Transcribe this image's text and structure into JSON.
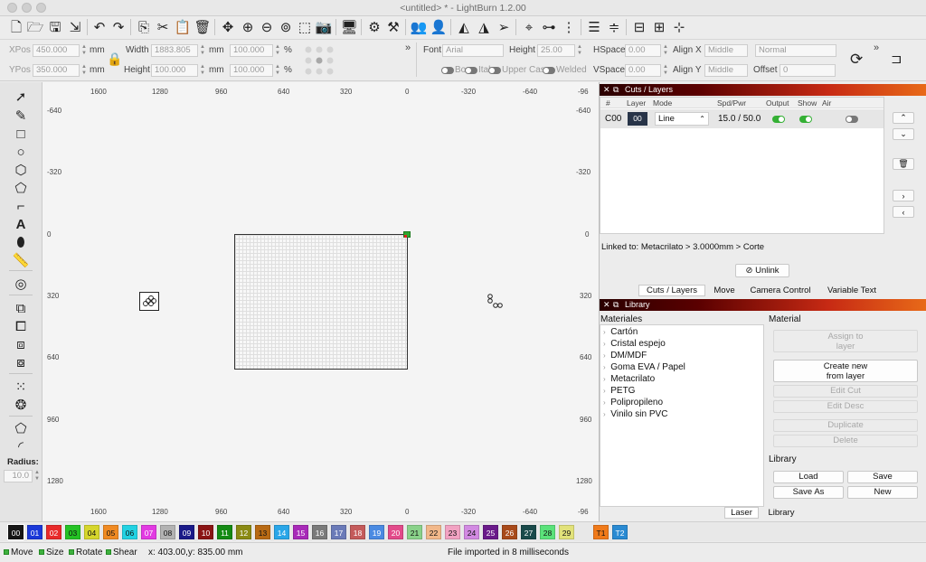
{
  "window": {
    "title": "<untitled> * - LightBurn 1.2.00"
  },
  "toolbar2": {
    "xpos_label": "XPos",
    "xpos_value": "450.000",
    "ypos_label": "YPos",
    "ypos_value": "350.000",
    "unit_mm": "mm",
    "width_label": "Width",
    "width_value": "1883.805",
    "height_label": "Height",
    "height_value": "100.000",
    "scale_w_value": "100.000",
    "scale_h_value": "100.000",
    "percent": "%",
    "font_label": "Font",
    "font_value": "Arial",
    "text_height_label": "Height",
    "text_height_value": "25.00",
    "hspace_label": "HSpace",
    "hspace_value": "0.00",
    "vspace_label": "VSpace",
    "vspace_value": "0.00",
    "alignx_label": "Align X",
    "alignx_value": "Middle",
    "aligny_label": "Align Y",
    "aligny_value": "Middle",
    "style_value": "Normal",
    "offset_label": "Offset",
    "offset_value": "0",
    "bold_label": "Bo",
    "italic_label": "Ital",
    "uppercase_label": "Upper Cas",
    "welded_label": "Welded",
    "overflow": "»"
  },
  "left_tools": {
    "radius_label": "Radius:",
    "radius_value": "10.0"
  },
  "rulers": {
    "top": [
      "1600",
      "1280",
      "960",
      "640",
      "320",
      "0",
      "-320",
      "-640",
      "-96"
    ],
    "bottom": [
      "1600",
      "1280",
      "960",
      "640",
      "320",
      "0",
      "-320",
      "-640",
      "-96"
    ],
    "left": [
      "-640",
      "-320",
      "0",
      "320",
      "640",
      "960",
      "1280"
    ],
    "right": [
      "-640",
      "-320",
      "0",
      "320",
      "640",
      "960",
      "1280"
    ]
  },
  "cuts": {
    "title": "Cuts / Layers",
    "headers": [
      "#",
      "Layer",
      "Mode",
      "Spd/Pwr",
      "Output",
      "Show",
      "Air"
    ],
    "row": {
      "id": "C00",
      "layer": "00",
      "mode": "Line",
      "spdpwr": "15.0 / 50.0",
      "layer_color": "#1a1a1a"
    },
    "linked": "Linked to: Metacrilato > 3.0000mm > Corte",
    "unlink": "Unlink",
    "tabs": [
      "Cuts / Layers",
      "Move",
      "Camera Control",
      "Variable Text"
    ]
  },
  "library": {
    "title": "Library",
    "materials_header": "Materiales",
    "materials": [
      "Cartón",
      "Cristal espejo",
      "DM/MDF",
      "Goma EVA / Papel",
      "Metacrilato",
      "PETG",
      "Polipropileno",
      "Vinilo sin PVC"
    ],
    "material_section": "Material",
    "assign": "Assign to layer",
    "create": "Create new from layer",
    "edit_cut": "Edit Cut",
    "edit_desc": "Edit Desc",
    "duplicate": "Duplicate",
    "delete": "Delete",
    "library_section": "Library",
    "load": "Load",
    "save": "Save",
    "save_as": "Save As",
    "new": "New",
    "bottom_tabs": [
      "Laser",
      "Library"
    ]
  },
  "palette": [
    {
      "label": "00",
      "color": "#161616",
      "fg": "#ffffff"
    },
    {
      "label": "01",
      "color": "#1a38d8",
      "fg": "#ffffff"
    },
    {
      "label": "02",
      "color": "#e82a2a",
      "fg": "#ffffff"
    },
    {
      "label": "03",
      "color": "#24c224",
      "fg": "#111111"
    },
    {
      "label": "04",
      "color": "#d6d62c",
      "fg": "#111111"
    },
    {
      "label": "05",
      "color": "#f08a22",
      "fg": "#111111"
    },
    {
      "label": "06",
      "color": "#22d2e2",
      "fg": "#111111"
    },
    {
      "label": "07",
      "color": "#e23ae2",
      "fg": "#ffffff"
    },
    {
      "label": "08",
      "color": "#b2b2b2",
      "fg": "#111111"
    },
    {
      "label": "09",
      "color": "#1a1a88",
      "fg": "#ffffff"
    },
    {
      "label": "10",
      "color": "#8a1414",
      "fg": "#ffffff"
    },
    {
      "label": "11",
      "color": "#148a14",
      "fg": "#ffffff"
    },
    {
      "label": "12",
      "color": "#8a8a14",
      "fg": "#ffffff"
    },
    {
      "label": "13",
      "color": "#b86a14",
      "fg": "#111111"
    },
    {
      "label": "14",
      "color": "#2aa6e8",
      "fg": "#ffffff"
    },
    {
      "label": "15",
      "color": "#a82ab8",
      "fg": "#ffffff"
    },
    {
      "label": "16",
      "color": "#7a7a7a",
      "fg": "#ffffff"
    },
    {
      "label": "17",
      "color": "#6a7ab8",
      "fg": "#ffffff"
    },
    {
      "label": "18",
      "color": "#c45a5a",
      "fg": "#ffffff"
    },
    {
      "label": "19",
      "color": "#4a8ae2",
      "fg": "#ffffff"
    },
    {
      "label": "20",
      "color": "#e24a8a",
      "fg": "#ffffff"
    },
    {
      "label": "21",
      "color": "#8ad28a",
      "fg": "#111111"
    },
    {
      "label": "22",
      "color": "#f2b88a",
      "fg": "#111111"
    },
    {
      "label": "23",
      "color": "#f2a2c2",
      "fg": "#111111"
    },
    {
      "label": "24",
      "color": "#d28ae2",
      "fg": "#111111"
    },
    {
      "label": "25",
      "color": "#6a1a8a",
      "fg": "#ffffff"
    },
    {
      "label": "26",
      "color": "#a84a1a",
      "fg": "#ffffff"
    },
    {
      "label": "27",
      "color": "#1a4a4a",
      "fg": "#ffffff"
    },
    {
      "label": "28",
      "color": "#5ae27a",
      "fg": "#111111"
    },
    {
      "label": "29",
      "color": "#e2e27a",
      "fg": "#111111"
    },
    {
      "label": "T1",
      "color": "#f07a1a",
      "fg": "#111111"
    },
    {
      "label": "T2",
      "color": "#2a8ad2",
      "fg": "#ffffff"
    }
  ],
  "status": {
    "move": "Move",
    "size": "Size",
    "rotate": "Rotate",
    "shear": "Shear",
    "coords": "x: 403.00,y: 835.00 mm",
    "message": "File imported in 8 milliseconds"
  }
}
